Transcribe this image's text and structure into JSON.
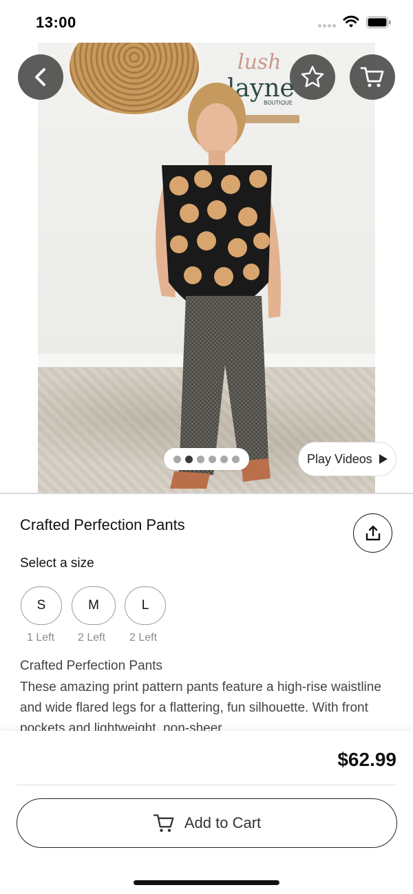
{
  "status_bar": {
    "time": "13:00",
    "icons": [
      "signal-icon",
      "wifi-icon",
      "battery-icon"
    ]
  },
  "hero": {
    "image_description_icon": "product-photo",
    "sign_text": "lush layne BOUTIQUE",
    "carousel": {
      "total": 6,
      "active_index": 1
    },
    "play_videos_label": "Play Videos",
    "buttons": {
      "back": "chevron-left-icon",
      "favorite": "star-icon",
      "cart": "cart-icon"
    }
  },
  "product": {
    "title": "Crafted Perfection Pants",
    "size_heading": "Select a size",
    "sizes": [
      {
        "label": "S",
        "stock": "1 Left"
      },
      {
        "label": "M",
        "stock": "2 Left"
      },
      {
        "label": "L",
        "stock": "2 Left"
      }
    ],
    "description_title": "Crafted Perfection Pants",
    "description": "These amazing print pattern pants feature a high-rise waistline and wide flared legs for a flattering, fun silhouette. With front pockets and lightweight, non-sheer"
  },
  "checkout": {
    "price": "$62.99",
    "add_to_cart_label": "Add to Cart"
  },
  "colors": {
    "overlay_button": "#464646",
    "dot_active": "#3a3a3a",
    "dot_inactive": "#a9a9a9",
    "text_primary": "#111111",
    "text_muted": "#8a8a8a"
  }
}
